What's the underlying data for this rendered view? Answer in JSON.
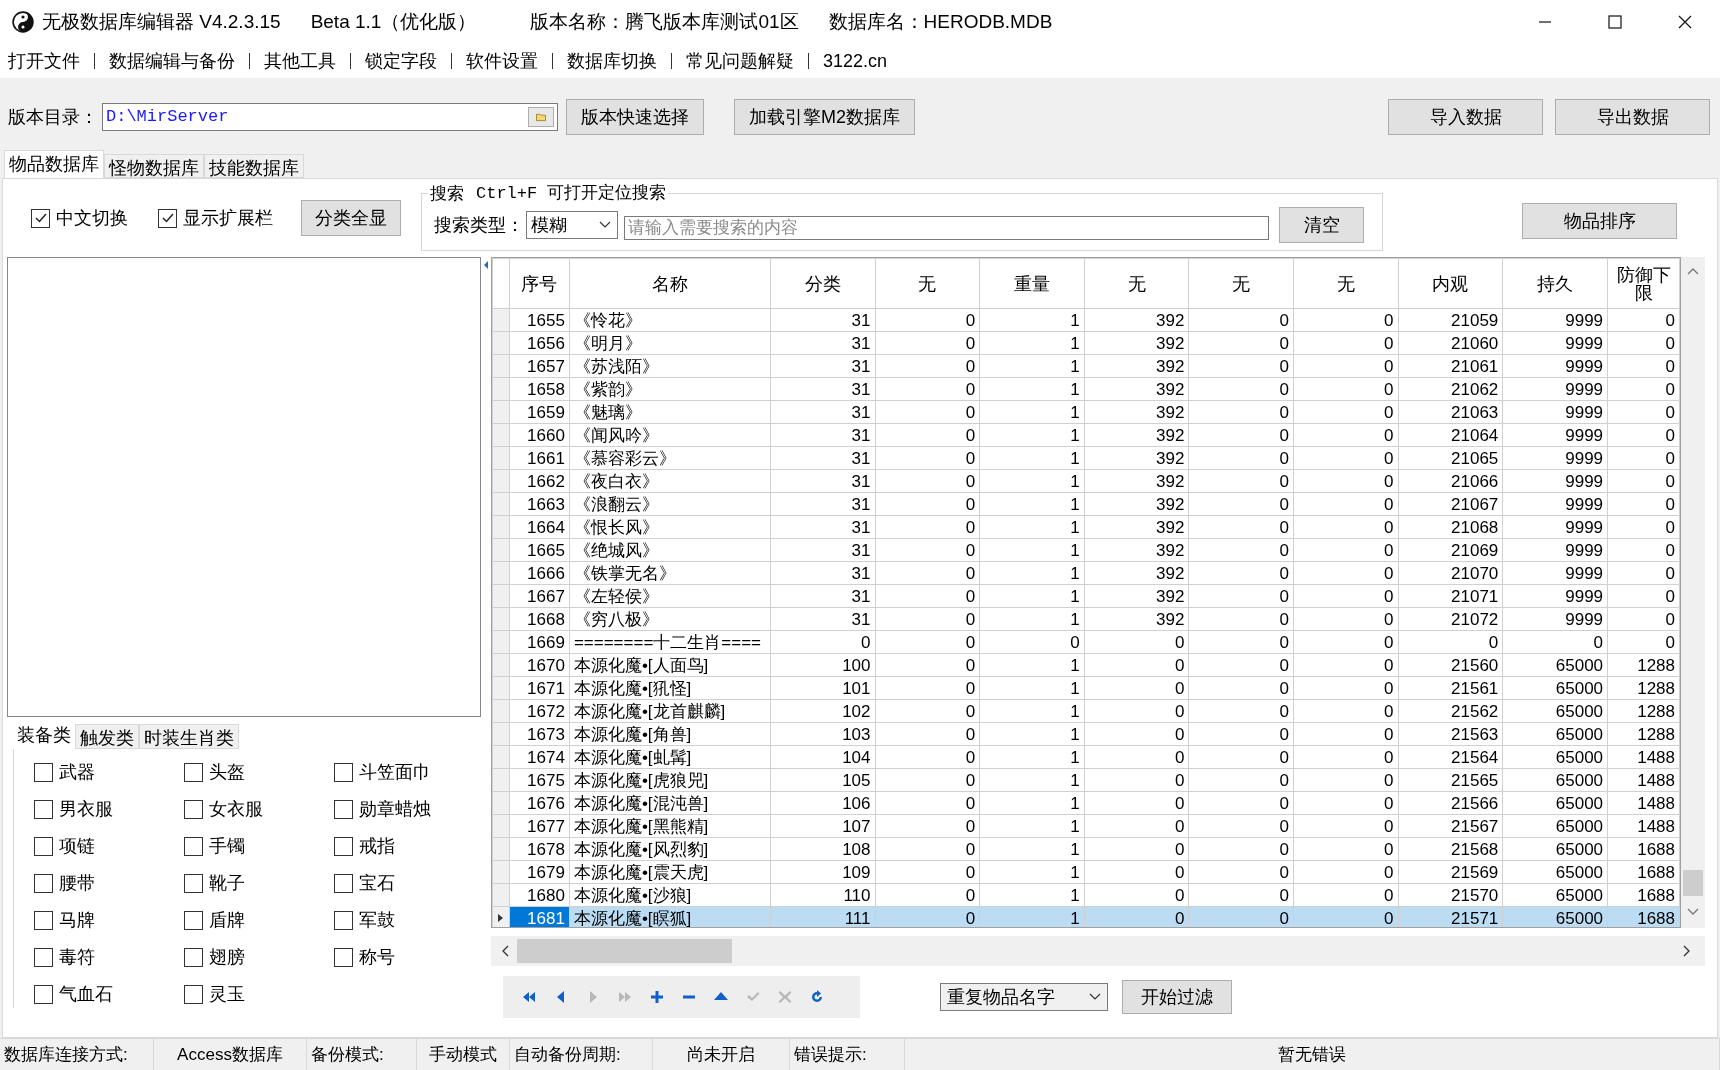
{
  "window": {
    "title": "无极数据库编辑器 V4.2.3.15",
    "subtitle": "Beta 1.1（优化版）",
    "version_name": "版本名称：腾飞版本库测试01区",
    "database_name": "数据库名：HERODB.MDB"
  },
  "menu": [
    "打开文件",
    "数据编辑与备份",
    "其他工具",
    "锁定字段",
    "软件设置",
    "数据库切换",
    "常见问题解疑",
    "3122.cn"
  ],
  "toolbar": {
    "dir_label": "版本目录：",
    "dir_value": "D:\\MirServer",
    "buttons": [
      "版本快速选择",
      "加载引擎M2数据库"
    ],
    "right_buttons": [
      "导入数据",
      "导出数据"
    ]
  },
  "tabs": [
    {
      "label": "物品数据库",
      "selected": true
    },
    {
      "label": "怪物数据库",
      "selected": false
    },
    {
      "label": "技能数据库",
      "selected": false
    }
  ],
  "options": {
    "checkboxes": [
      {
        "label": "中文切换",
        "checked": true
      },
      {
        "label": "显示扩展栏",
        "checked": true
      }
    ],
    "show_all_button": "分类全显"
  },
  "search": {
    "title": "搜索",
    "hint": "Ctrl+F 可打开定位搜索",
    "type_label": "搜索类型：",
    "type_value": "模糊",
    "placeholder": "请输入需要搜索的内容",
    "clear_button": "清空"
  },
  "sort_button": "物品排序",
  "category_tabs": [
    {
      "label": "装备类",
      "selected": true
    },
    {
      "label": "触发类",
      "selected": false
    },
    {
      "label": "时装生肖类",
      "selected": false
    }
  ],
  "categories": [
    {
      "label": "武器",
      "checked": false
    },
    {
      "label": "头盔",
      "checked": false
    },
    {
      "label": "斗笠面巾",
      "checked": false
    },
    {
      "label": "男衣服",
      "checked": false
    },
    {
      "label": "女衣服",
      "checked": false
    },
    {
      "label": "勋章蜡烛",
      "checked": false
    },
    {
      "label": "项链",
      "checked": false
    },
    {
      "label": "手镯",
      "checked": false
    },
    {
      "label": "戒指",
      "checked": false
    },
    {
      "label": "腰带",
      "checked": false
    },
    {
      "label": "靴子",
      "checked": false
    },
    {
      "label": "宝石",
      "checked": false
    },
    {
      "label": "马牌",
      "checked": false
    },
    {
      "label": "盾牌",
      "checked": false
    },
    {
      "label": "军鼓",
      "checked": false
    },
    {
      "label": "毒符",
      "checked": false
    },
    {
      "label": "翅膀",
      "checked": false
    },
    {
      "label": "称号",
      "checked": false
    },
    {
      "label": "气血石",
      "checked": false
    },
    {
      "label": "灵玉",
      "checked": false
    }
  ],
  "table": {
    "columns": [
      "序号",
      "名称",
      "分类",
      "无",
      "重量",
      "无",
      "无",
      "无",
      "内观",
      "持久",
      "防御下限"
    ],
    "rows": [
      {
        "cells": [
          "1655",
          "《怜花》",
          "31",
          "0",
          "1",
          "392",
          "0",
          "0",
          "21059",
          "9999",
          "0"
        ],
        "selected": false
      },
      {
        "cells": [
          "1656",
          "《明月》",
          "31",
          "0",
          "1",
          "392",
          "0",
          "0",
          "21060",
          "9999",
          "0"
        ],
        "selected": false
      },
      {
        "cells": [
          "1657",
          "《苏浅陌》",
          "31",
          "0",
          "1",
          "392",
          "0",
          "0",
          "21061",
          "9999",
          "0"
        ],
        "selected": false
      },
      {
        "cells": [
          "1658",
          "《紫韵》",
          "31",
          "0",
          "1",
          "392",
          "0",
          "0",
          "21062",
          "9999",
          "0"
        ],
        "selected": false
      },
      {
        "cells": [
          "1659",
          "《魅璃》",
          "31",
          "0",
          "1",
          "392",
          "0",
          "0",
          "21063",
          "9999",
          "0"
        ],
        "selected": false
      },
      {
        "cells": [
          "1660",
          "《闻风吟》",
          "31",
          "0",
          "1",
          "392",
          "0",
          "0",
          "21064",
          "9999",
          "0"
        ],
        "selected": false
      },
      {
        "cells": [
          "1661",
          "《慕容彩云》",
          "31",
          "0",
          "1",
          "392",
          "0",
          "0",
          "21065",
          "9999",
          "0"
        ],
        "selected": false
      },
      {
        "cells": [
          "1662",
          "《夜白衣》",
          "31",
          "0",
          "1",
          "392",
          "0",
          "0",
          "21066",
          "9999",
          "0"
        ],
        "selected": false
      },
      {
        "cells": [
          "1663",
          "《浪翻云》",
          "31",
          "0",
          "1",
          "392",
          "0",
          "0",
          "21067",
          "9999",
          "0"
        ],
        "selected": false
      },
      {
        "cells": [
          "1664",
          "《恨长风》",
          "31",
          "0",
          "1",
          "392",
          "0",
          "0",
          "21068",
          "9999",
          "0"
        ],
        "selected": false
      },
      {
        "cells": [
          "1665",
          "《绝城风》",
          "31",
          "0",
          "1",
          "392",
          "0",
          "0",
          "21069",
          "9999",
          "0"
        ],
        "selected": false
      },
      {
        "cells": [
          "1666",
          "《铁掌无名》",
          "31",
          "0",
          "1",
          "392",
          "0",
          "0",
          "21070",
          "9999",
          "0"
        ],
        "selected": false
      },
      {
        "cells": [
          "1667",
          "《左轻侯》",
          "31",
          "0",
          "1",
          "392",
          "0",
          "0",
          "21071",
          "9999",
          "0"
        ],
        "selected": false
      },
      {
        "cells": [
          "1668",
          "《穷八极》",
          "31",
          "0",
          "1",
          "392",
          "0",
          "0",
          "21072",
          "9999",
          "0"
        ],
        "selected": false
      },
      {
        "cells": [
          "1669",
          "========十二生肖====",
          "0",
          "0",
          "0",
          "0",
          "0",
          "0",
          "0",
          "0",
          "0"
        ],
        "selected": false
      },
      {
        "cells": [
          "1670",
          "本源化魔•[人面鸟]",
          "100",
          "0",
          "1",
          "0",
          "0",
          "0",
          "21560",
          "65000",
          "1288"
        ],
        "selected": false
      },
      {
        "cells": [
          "1671",
          "本源化魔•[犼怪]",
          "101",
          "0",
          "1",
          "0",
          "0",
          "0",
          "21561",
          "65000",
          "1288"
        ],
        "selected": false
      },
      {
        "cells": [
          "1672",
          "本源化魔•[龙首麒麟]",
          "102",
          "0",
          "1",
          "0",
          "0",
          "0",
          "21562",
          "65000",
          "1288"
        ],
        "selected": false
      },
      {
        "cells": [
          "1673",
          "本源化魔•[角兽]",
          "103",
          "0",
          "1",
          "0",
          "0",
          "0",
          "21563",
          "65000",
          "1288"
        ],
        "selected": false
      },
      {
        "cells": [
          "1674",
          "本源化魔•[虬髯]",
          "104",
          "0",
          "1",
          "0",
          "0",
          "0",
          "21564",
          "65000",
          "1488"
        ],
        "selected": false
      },
      {
        "cells": [
          "1675",
          "本源化魔•[虎狼兕]",
          "105",
          "0",
          "1",
          "0",
          "0",
          "0",
          "21565",
          "65000",
          "1488"
        ],
        "selected": false
      },
      {
        "cells": [
          "1676",
          "本源化魔•[混沌兽]",
          "106",
          "0",
          "1",
          "0",
          "0",
          "0",
          "21566",
          "65000",
          "1488"
        ],
        "selected": false
      },
      {
        "cells": [
          "1677",
          "本源化魔•[黑熊精]",
          "107",
          "0",
          "1",
          "0",
          "0",
          "0",
          "21567",
          "65000",
          "1488"
        ],
        "selected": false
      },
      {
        "cells": [
          "1678",
          "本源化魔•[风烈豹]",
          "108",
          "0",
          "1",
          "0",
          "0",
          "0",
          "21568",
          "65000",
          "1688"
        ],
        "selected": false
      },
      {
        "cells": [
          "1679",
          "本源化魔•[震天虎]",
          "109",
          "0",
          "1",
          "0",
          "0",
          "0",
          "21569",
          "65000",
          "1688"
        ],
        "selected": false
      },
      {
        "cells": [
          "1680",
          "本源化魔•[沙狼]",
          "110",
          "0",
          "1",
          "0",
          "0",
          "0",
          "21570",
          "65000",
          "1688"
        ],
        "selected": false
      },
      {
        "cells": [
          "1681",
          "本源化魔•[瞑狐]",
          "111",
          "0",
          "1",
          "0",
          "0",
          "0",
          "21571",
          "65000",
          "1688"
        ],
        "selected": true
      }
    ]
  },
  "nav_buttons": [
    {
      "kind": "first",
      "disabled": false
    },
    {
      "kind": "prior",
      "disabled": false
    },
    {
      "kind": "next",
      "disabled": true
    },
    {
      "kind": "last",
      "disabled": true
    },
    {
      "kind": "insert",
      "disabled": false
    },
    {
      "kind": "delete",
      "disabled": false
    },
    {
      "kind": "edit",
      "disabled": false
    },
    {
      "kind": "post",
      "disabled": true
    },
    {
      "kind": "cancel",
      "disabled": true
    },
    {
      "kind": "refresh",
      "disabled": false
    }
  ],
  "filter": {
    "value": "重复物品名字",
    "button": "开始过滤"
  },
  "status_bar": [
    {
      "label": "数据库连接方式:",
      "value": "Access数据库"
    },
    {
      "label": "备份模式:",
      "value": "手动模式"
    },
    {
      "label": "自动备份周期:",
      "value": "尚未开启"
    },
    {
      "label": "错误提示:",
      "value": "暂无错误"
    }
  ]
}
